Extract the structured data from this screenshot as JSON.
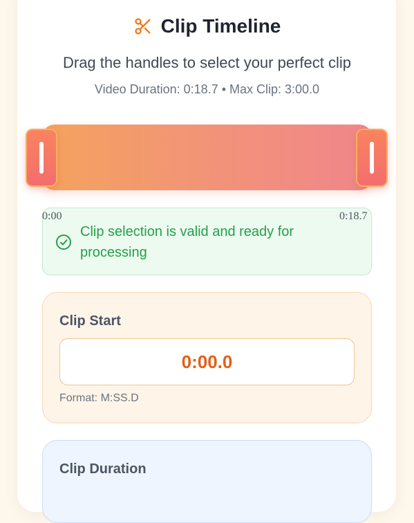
{
  "header": {
    "icon": "scissors-icon",
    "title": "Clip Timeline",
    "subtitle": "Drag the handles to select your perfect clip",
    "meta": "Video Duration: 0:18.7 • Max Clip: 3:00.0"
  },
  "timeline": {
    "start_label": "0:00",
    "end_label": "0:18.7",
    "selection_start_fraction": 0,
    "selection_end_fraction": 1,
    "colors": {
      "gradient_start": "#f4a35e",
      "gradient_end": "#f0868a"
    }
  },
  "status": {
    "icon": "check-circle-icon",
    "text": "Clip selection is valid and ready for processing",
    "color": "#22a04a"
  },
  "clip_start": {
    "label": "Clip Start",
    "value": "0:00.0",
    "format_hint": "Format: M:SS.D",
    "accent": "#e45f16"
  },
  "clip_duration": {
    "label": "Clip Duration"
  }
}
